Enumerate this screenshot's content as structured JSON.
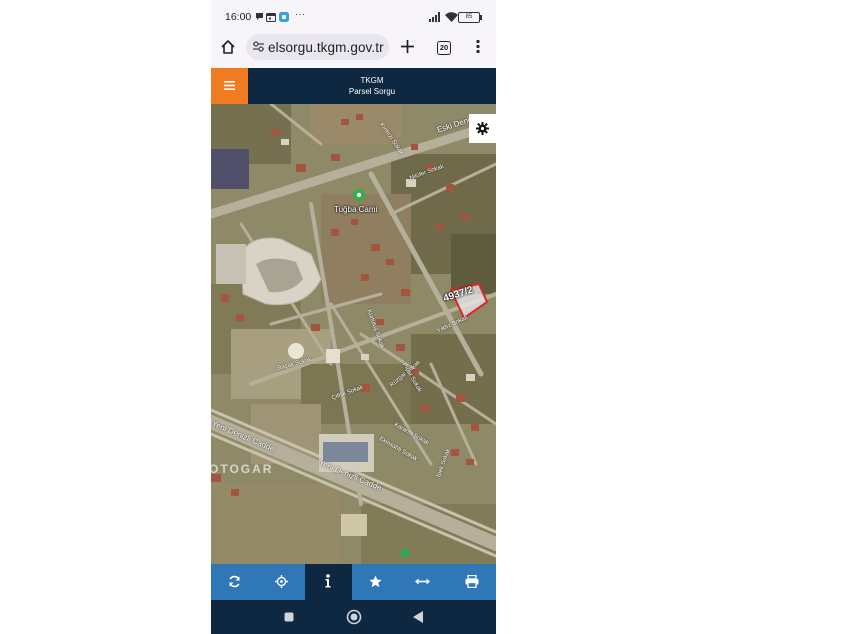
{
  "status_bar": {
    "time": "16:00",
    "overflow": "···",
    "battery": "85",
    "icons": [
      "notification-icon",
      "calendar-icon",
      "app-icon",
      "signal-icon",
      "wifi-icon",
      "battery-icon"
    ]
  },
  "browser": {
    "url": "parselsorgu.tkgm.gov.tr",
    "url_visible": "elsorgu.tkgm.gov.tr",
    "tab_count": "20"
  },
  "app_header": {
    "title": "TKGM",
    "subtitle": "Parsel Sorgu"
  },
  "map": {
    "parcel_label": "4937/2",
    "labels": {
      "mosque": "Tuğba Cami",
      "otogar": "OTOGAR",
      "eski_denizli": "Eski Denizli",
      "yeni_denizli_1": "Yeni Denizli Cadde",
      "yeni_denizli_2": "Yeni Denizli Cadde",
      "r1": "Kırmızı Sokak",
      "r2": "Nilüfer Sokak",
      "r3": "Kurtuluş Sokak",
      "r4": "Başak Sokak",
      "r5": "Çiftlik Sokak",
      "r6": "Karanfil Sokak",
      "r7": "Ekinsahti Sokak",
      "r8": "İpek Sokak",
      "r9": "Pınar Sokak",
      "r10": "Rüzgar Sokak",
      "r11": "Yıldız Sokak"
    }
  },
  "toolbar": {
    "items": [
      "refresh",
      "locate",
      "info",
      "favorites",
      "measure",
      "print"
    ],
    "active": "info"
  },
  "colors": {
    "header_bg": "#0e2841",
    "menu_accent": "#f07c22",
    "toolbar_bg": "#2f77b7",
    "toolbar_active": "#0e2841",
    "parcel_outline": "#e0262b"
  }
}
